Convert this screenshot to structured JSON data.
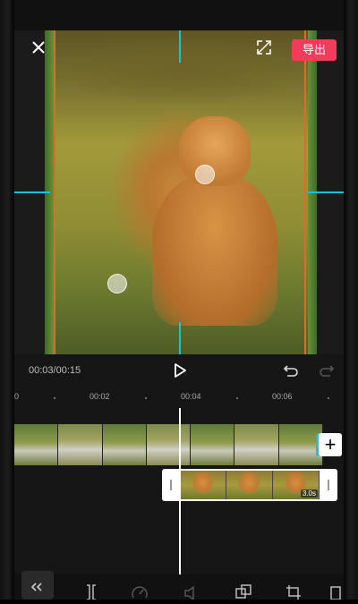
{
  "header": {
    "close_icon": "close-icon",
    "fullscreen_icon": "fullscreen-icon",
    "export_label": "导出"
  },
  "playback": {
    "current_time": "00:03",
    "separator": "/",
    "total_time": "00:15",
    "play_icon": "play-icon",
    "undo_icon": "undo-icon",
    "redo_icon": "redo-icon"
  },
  "timeline": {
    "ruler_labels": [
      "0",
      "00:02",
      "00:04",
      "00:06"
    ],
    "main_track_frames": 7,
    "overlay_clip_duration": "3.0s",
    "add_clip_label": "+"
  },
  "colors": {
    "accent": "#19c2d6",
    "export": "#f23c5c",
    "guide_orange": "#e06a2a"
  },
  "toolbar": {
    "items": [
      "back-icon",
      "split-icon",
      "speed-icon",
      "volume-icon",
      "overlay-icon",
      "crop-icon",
      "more-icon"
    ]
  }
}
